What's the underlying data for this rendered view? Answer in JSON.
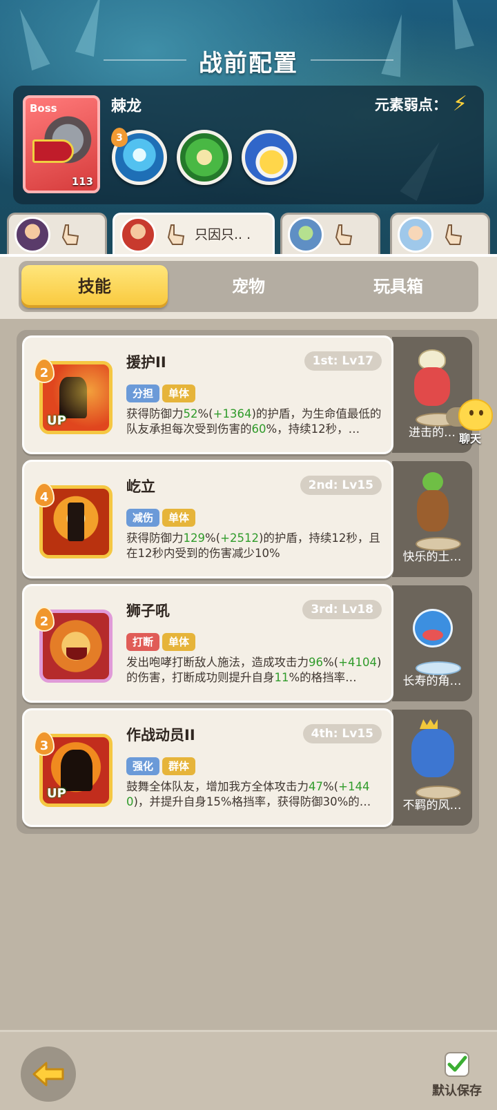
{
  "page": {
    "title": "战前配置"
  },
  "boss": {
    "tag": "Boss",
    "name": "棘龙",
    "level": "113",
    "weakness_label": "元素弱点：",
    "weakness_icon": "lightning-icon",
    "skill_orbs": [
      {
        "icon": "water-burst-icon",
        "badge": "3",
        "color": "#3d9ad8"
      },
      {
        "icon": "green-scroll-icon",
        "badge": "",
        "color": "#3aa53a"
      },
      {
        "icon": "yellow-chick-icon",
        "badge": "",
        "color": "#2f6fcf"
      }
    ]
  },
  "heroes": [
    {
      "avatar": "hero-girl-avatar",
      "note": ""
    },
    {
      "avatar": "hero-red-hair-avatar",
      "note": "只因只.. ."
    },
    {
      "avatar": "hero-green-creature-avatar",
      "note": ""
    },
    {
      "avatar": "hero-blue-hair-avatar",
      "note": ""
    }
  ],
  "tabs": [
    "技能",
    "宠物",
    "玩具箱"
  ],
  "skills": [
    {
      "name": "援护II",
      "level": "1st: Lv17",
      "badge": "2",
      "up": "UP",
      "tags": [
        {
          "text": "分担",
          "color": "blue"
        },
        {
          "text": "单体",
          "color": "yellow"
        }
      ],
      "desc": [
        "获得防御力",
        "52",
        "%(",
        "+1364",
        ")的护盾，为生命值最低的队友承担每次受到伤害的",
        "60",
        "%，持续12秒，…"
      ],
      "pet": "进击的…"
    },
    {
      "name": "屹立",
      "level": "2nd: Lv15",
      "badge": "4",
      "up": "",
      "tags": [
        {
          "text": "减伤",
          "color": "blue"
        },
        {
          "text": "单体",
          "color": "yellow"
        }
      ],
      "desc": [
        "获得防御力",
        "129",
        "%(",
        "+2512",
        ")的护盾，持续12秒，且在12秒内受到的伤害减少10%",
        "",
        ""
      ],
      "pet": "快乐的土…"
    },
    {
      "name": "狮子吼",
      "level": "3rd: Lv18",
      "badge": "2",
      "up": "",
      "tags": [
        {
          "text": "打断",
          "color": "red"
        },
        {
          "text": "单体",
          "color": "yellow"
        }
      ],
      "desc": [
        "发出咆哮打断敌人施法，造成攻击力",
        "96",
        "%(",
        "+4104",
        ")的伤害，打断成功则提升自身",
        "11",
        "%的格挡率…"
      ],
      "pet": "长寿的角…"
    },
    {
      "name": "作战动员II",
      "level": "4th: Lv15",
      "badge": "3",
      "up": "UP",
      "tags": [
        {
          "text": "强化",
          "color": "blue"
        },
        {
          "text": "群体",
          "color": "yellow"
        }
      ],
      "desc": [
        "鼓舞全体队友，增加我方全体攻击力",
        "47",
        "%(",
        "+1440",
        ")，并提升自身15%格挡率，获得防御30%的…",
        "",
        ""
      ],
      "pet": "不羁的风…"
    }
  ],
  "chat": {
    "label": "聊天"
  },
  "footer": {
    "save_label": "默认保存"
  }
}
